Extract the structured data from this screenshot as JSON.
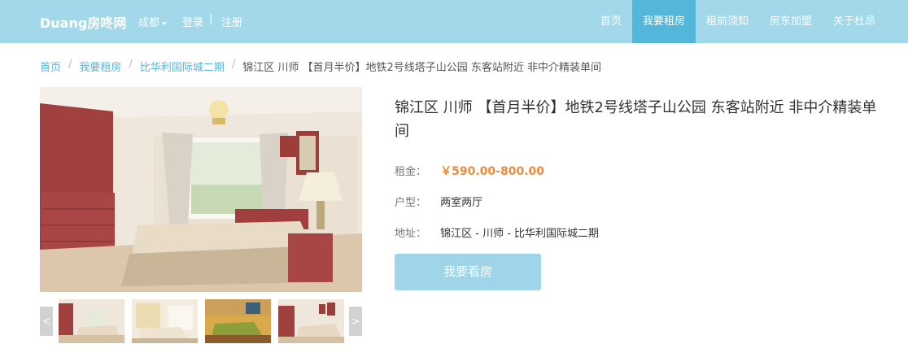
{
  "navbar": {
    "brand": "Duang房咚网",
    "city": "成都",
    "login": "登录",
    "separator": "|",
    "register": "注册",
    "links": [
      {
        "label": "首页",
        "active": false
      },
      {
        "label": "我要租房",
        "active": true
      },
      {
        "label": "租前须知",
        "active": false
      },
      {
        "label": "房东加盟",
        "active": false
      },
      {
        "label": "关于杜昂",
        "active": false
      }
    ]
  },
  "breadcrumb": {
    "items": [
      "首页",
      "我要租房",
      "比华利国际城二期"
    ],
    "separator": "/",
    "current": "锦江区 川师 【首月半价】地铁2号线塔子山公园 东客站附近 非中介精装单间"
  },
  "gallery": {
    "prev_label": "<",
    "next_label": ">",
    "thumbnail_count": 4
  },
  "listing": {
    "title": "锦江区 川师 【首月半价】地铁2号线塔子山公园 东客站附近 非中介精装单间",
    "rent_label": "租金：",
    "rent_value": "￥590.00-800.00",
    "layout_label": "户型：",
    "layout_value": "两室两厅",
    "address_label": "地址：",
    "address_value": "锦江区 - 川师 - 比华利国际城二期",
    "cta": "我要看房"
  },
  "colors": {
    "navbar_bg": "#a2d8ea",
    "nav_active_bg": "#54b6da",
    "link": "#5bb5da",
    "price": "#f08a3c",
    "cta_bg": "#9fd4e9"
  }
}
